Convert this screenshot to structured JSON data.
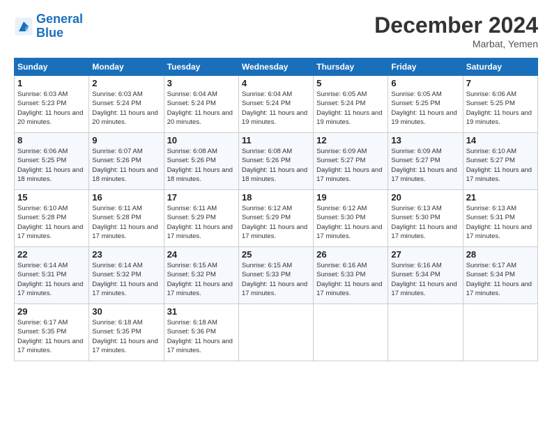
{
  "logo": {
    "line1": "General",
    "line2": "Blue"
  },
  "title": "December 2024",
  "location": "Marbat, Yemen",
  "weekdays": [
    "Sunday",
    "Monday",
    "Tuesday",
    "Wednesday",
    "Thursday",
    "Friday",
    "Saturday"
  ],
  "weeks": [
    [
      {
        "day": "1",
        "sunrise": "Sunrise: 6:03 AM",
        "sunset": "Sunset: 5:23 PM",
        "daylight": "Daylight: 11 hours and 20 minutes."
      },
      {
        "day": "2",
        "sunrise": "Sunrise: 6:03 AM",
        "sunset": "Sunset: 5:24 PM",
        "daylight": "Daylight: 11 hours and 20 minutes."
      },
      {
        "day": "3",
        "sunrise": "Sunrise: 6:04 AM",
        "sunset": "Sunset: 5:24 PM",
        "daylight": "Daylight: 11 hours and 20 minutes."
      },
      {
        "day": "4",
        "sunrise": "Sunrise: 6:04 AM",
        "sunset": "Sunset: 5:24 PM",
        "daylight": "Daylight: 11 hours and 19 minutes."
      },
      {
        "day": "5",
        "sunrise": "Sunrise: 6:05 AM",
        "sunset": "Sunset: 5:24 PM",
        "daylight": "Daylight: 11 hours and 19 minutes."
      },
      {
        "day": "6",
        "sunrise": "Sunrise: 6:05 AM",
        "sunset": "Sunset: 5:25 PM",
        "daylight": "Daylight: 11 hours and 19 minutes."
      },
      {
        "day": "7",
        "sunrise": "Sunrise: 6:06 AM",
        "sunset": "Sunset: 5:25 PM",
        "daylight": "Daylight: 11 hours and 19 minutes."
      }
    ],
    [
      {
        "day": "8",
        "sunrise": "Sunrise: 6:06 AM",
        "sunset": "Sunset: 5:25 PM",
        "daylight": "Daylight: 11 hours and 18 minutes."
      },
      {
        "day": "9",
        "sunrise": "Sunrise: 6:07 AM",
        "sunset": "Sunset: 5:26 PM",
        "daylight": "Daylight: 11 hours and 18 minutes."
      },
      {
        "day": "10",
        "sunrise": "Sunrise: 6:08 AM",
        "sunset": "Sunset: 5:26 PM",
        "daylight": "Daylight: 11 hours and 18 minutes."
      },
      {
        "day": "11",
        "sunrise": "Sunrise: 6:08 AM",
        "sunset": "Sunset: 5:26 PM",
        "daylight": "Daylight: 11 hours and 18 minutes."
      },
      {
        "day": "12",
        "sunrise": "Sunrise: 6:09 AM",
        "sunset": "Sunset: 5:27 PM",
        "daylight": "Daylight: 11 hours and 17 minutes."
      },
      {
        "day": "13",
        "sunrise": "Sunrise: 6:09 AM",
        "sunset": "Sunset: 5:27 PM",
        "daylight": "Daylight: 11 hours and 17 minutes."
      },
      {
        "day": "14",
        "sunrise": "Sunrise: 6:10 AM",
        "sunset": "Sunset: 5:27 PM",
        "daylight": "Daylight: 11 hours and 17 minutes."
      }
    ],
    [
      {
        "day": "15",
        "sunrise": "Sunrise: 6:10 AM",
        "sunset": "Sunset: 5:28 PM",
        "daylight": "Daylight: 11 hours and 17 minutes."
      },
      {
        "day": "16",
        "sunrise": "Sunrise: 6:11 AM",
        "sunset": "Sunset: 5:28 PM",
        "daylight": "Daylight: 11 hours and 17 minutes."
      },
      {
        "day": "17",
        "sunrise": "Sunrise: 6:11 AM",
        "sunset": "Sunset: 5:29 PM",
        "daylight": "Daylight: 11 hours and 17 minutes."
      },
      {
        "day": "18",
        "sunrise": "Sunrise: 6:12 AM",
        "sunset": "Sunset: 5:29 PM",
        "daylight": "Daylight: 11 hours and 17 minutes."
      },
      {
        "day": "19",
        "sunrise": "Sunrise: 6:12 AM",
        "sunset": "Sunset: 5:30 PM",
        "daylight": "Daylight: 11 hours and 17 minutes."
      },
      {
        "day": "20",
        "sunrise": "Sunrise: 6:13 AM",
        "sunset": "Sunset: 5:30 PM",
        "daylight": "Daylight: 11 hours and 17 minutes."
      },
      {
        "day": "21",
        "sunrise": "Sunrise: 6:13 AM",
        "sunset": "Sunset: 5:31 PM",
        "daylight": "Daylight: 11 hours and 17 minutes."
      }
    ],
    [
      {
        "day": "22",
        "sunrise": "Sunrise: 6:14 AM",
        "sunset": "Sunset: 5:31 PM",
        "daylight": "Daylight: 11 hours and 17 minutes."
      },
      {
        "day": "23",
        "sunrise": "Sunrise: 6:14 AM",
        "sunset": "Sunset: 5:32 PM",
        "daylight": "Daylight: 11 hours and 17 minutes."
      },
      {
        "day": "24",
        "sunrise": "Sunrise: 6:15 AM",
        "sunset": "Sunset: 5:32 PM",
        "daylight": "Daylight: 11 hours and 17 minutes."
      },
      {
        "day": "25",
        "sunrise": "Sunrise: 6:15 AM",
        "sunset": "Sunset: 5:33 PM",
        "daylight": "Daylight: 11 hours and 17 minutes."
      },
      {
        "day": "26",
        "sunrise": "Sunrise: 6:16 AM",
        "sunset": "Sunset: 5:33 PM",
        "daylight": "Daylight: 11 hours and 17 minutes."
      },
      {
        "day": "27",
        "sunrise": "Sunrise: 6:16 AM",
        "sunset": "Sunset: 5:34 PM",
        "daylight": "Daylight: 11 hours and 17 minutes."
      },
      {
        "day": "28",
        "sunrise": "Sunrise: 6:17 AM",
        "sunset": "Sunset: 5:34 PM",
        "daylight": "Daylight: 11 hours and 17 minutes."
      }
    ],
    [
      {
        "day": "29",
        "sunrise": "Sunrise: 6:17 AM",
        "sunset": "Sunset: 5:35 PM",
        "daylight": "Daylight: 11 hours and 17 minutes."
      },
      {
        "day": "30",
        "sunrise": "Sunrise: 6:18 AM",
        "sunset": "Sunset: 5:35 PM",
        "daylight": "Daylight: 11 hours and 17 minutes."
      },
      {
        "day": "31",
        "sunrise": "Sunrise: 6:18 AM",
        "sunset": "Sunset: 5:36 PM",
        "daylight": "Daylight: 11 hours and 17 minutes."
      },
      null,
      null,
      null,
      null
    ]
  ]
}
